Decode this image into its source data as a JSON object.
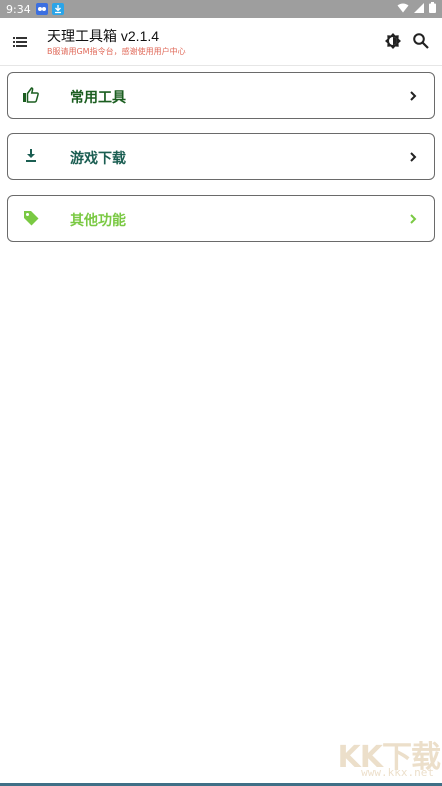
{
  "status_bar": {
    "time": "9:34"
  },
  "app_bar": {
    "title": "天理工具箱 v2.1.4",
    "subtitle": "B服请用GM指令台，感谢使用用户中心"
  },
  "menu": [
    {
      "label": "常用工具",
      "icon": "thumb-up-icon",
      "color": "#1b5e20"
    },
    {
      "label": "游戏下载",
      "icon": "download-icon",
      "color": "#1b5e52"
    },
    {
      "label": "其他功能",
      "icon": "tag-icon",
      "color": "#7ac943"
    }
  ],
  "watermark": {
    "big": "KK下载",
    "small": "www.kkx.net"
  }
}
